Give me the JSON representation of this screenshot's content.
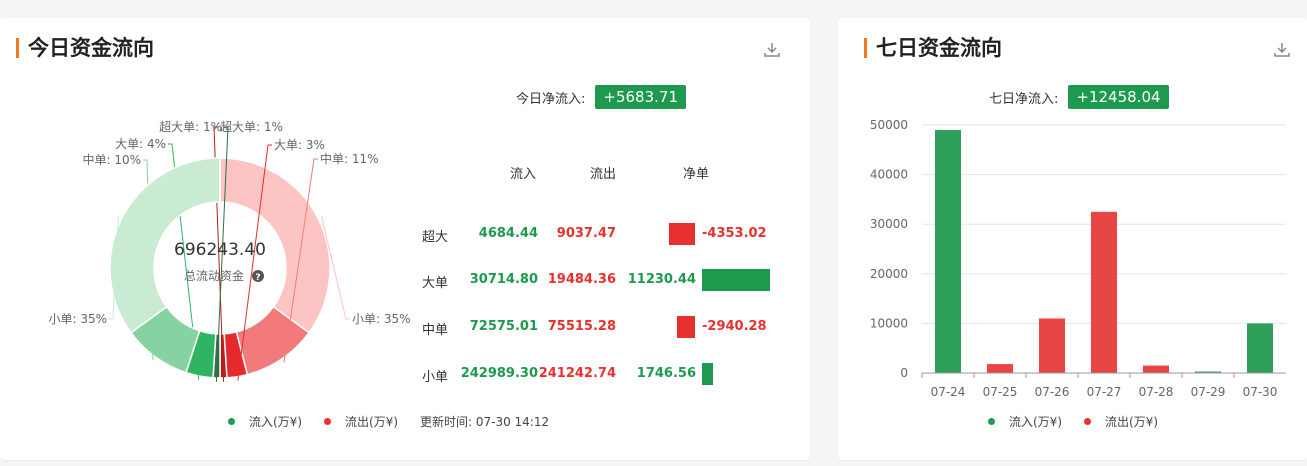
{
  "today": {
    "title": "今日资金流向",
    "net_label": "今日净流入:",
    "net_value": "+5683.71",
    "center_value": "696243.40",
    "center_label": "总流动资金",
    "headers": {
      "in": "流入",
      "out": "流出",
      "net": "净单"
    },
    "rows": [
      {
        "cat": "超大",
        "in": "4684.44",
        "out": "9037.47",
        "net": "-4353.02",
        "net_num": -4353.02
      },
      {
        "cat": "大单",
        "in": "30714.80",
        "out": "19484.36",
        "net": "11230.44",
        "net_num": 11230.44
      },
      {
        "cat": "中单",
        "in": "72575.01",
        "out": "75515.28",
        "net": "-2940.28",
        "net_num": -2940.28
      },
      {
        "cat": "小单",
        "in": "242989.30",
        "out": "241242.74",
        "net": "1746.56",
        "net_num": 1746.56
      }
    ],
    "legend": {
      "in": "流入(万¥)",
      "out": "流出(万¥)",
      "update": "更新时间: 07-30 14:12"
    }
  },
  "week": {
    "title": "七日资金流向",
    "net_label": "七日净流入:",
    "net_value": "+12458.04",
    "legend": {
      "in": "流入(万¥)",
      "out": "流出(万¥)"
    }
  },
  "colors": {
    "green": "#1d9a4e",
    "red": "#e8312f",
    "accent": "#f07b1e"
  },
  "chart_data": [
    {
      "type": "pie",
      "donut": true,
      "center_value": "696243.40",
      "slices": [
        {
          "label": "小单: 35%",
          "value": 35,
          "color": "#fdc4c4",
          "side": "right"
        },
        {
          "label": "中单: 11%",
          "value": 11,
          "color": "#f27a7a",
          "side": "right"
        },
        {
          "label": "大单: 3%",
          "value": 3,
          "color": "#e42a2a",
          "side": "right"
        },
        {
          "label": "超大单: 1%",
          "value": 1,
          "color": "#b81c1c",
          "side": "right"
        },
        {
          "label": "超大单: 1%",
          "value": 1,
          "color": "#2f6f48",
          "side": "left"
        },
        {
          "label": "大单: 4%",
          "value": 4,
          "color": "#2fb562",
          "side": "left"
        },
        {
          "label": "中单: 10%",
          "value": 10,
          "color": "#86d3a1",
          "side": "left"
        },
        {
          "label": "小单: 35%",
          "value": 35,
          "color": "#c9ebd3",
          "side": "left"
        }
      ]
    },
    {
      "type": "bar",
      "categories": [
        "07-24",
        "07-25",
        "07-26",
        "07-27",
        "07-28",
        "07-29",
        "07-30"
      ],
      "values": [
        49000,
        1800,
        11000,
        32500,
        1500,
        300,
        10000
      ],
      "bar_colors": [
        "#2fa05a",
        "#e84545",
        "#e84545",
        "#e84545",
        "#e84545",
        "#2fa05a",
        "#2fa05a"
      ],
      "yticks": [
        0,
        10000,
        20000,
        30000,
        40000,
        50000
      ],
      "ylim": [
        0,
        50000
      ],
      "grid": true
    }
  ]
}
